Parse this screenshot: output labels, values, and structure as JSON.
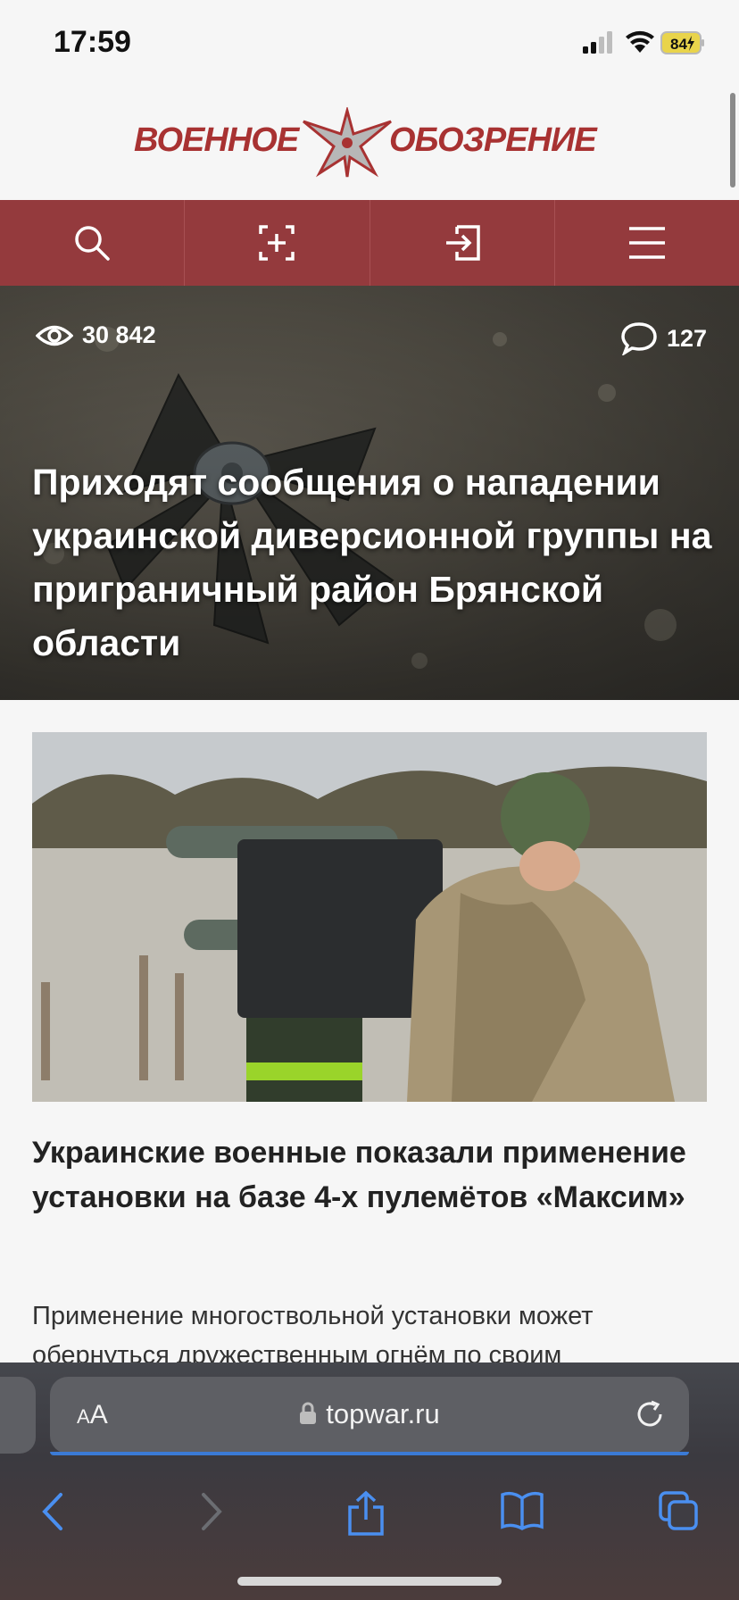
{
  "status": {
    "time": "17:59",
    "battery": "84"
  },
  "logo": {
    "left_word": "ВОЕННОЕ",
    "right_word": "ОБОЗРЕНИЕ"
  },
  "nav": {
    "items": [
      "search-icon",
      "add-icon",
      "login-icon",
      "menu-icon"
    ]
  },
  "hero": {
    "views": "30 842",
    "comments": "127",
    "title": "Приходят сообщения о нападении украинской диверсионной группы на приграничный район Брянской области"
  },
  "article": {
    "title": "Украинские военные показали применение установки на базе 4-х пулемётов «Максим»",
    "excerpt": "Применение многоствольной установки может обернуться дружественным огнём по своим"
  },
  "browser": {
    "aa_label_small": "A",
    "aa_label_big": "A",
    "domain": "topwar.ru",
    "toolbar": [
      "back-icon",
      "forward-icon",
      "share-icon",
      "bookmarks-icon",
      "tabs-icon"
    ]
  },
  "colors": {
    "brand": "#943a3d",
    "logo_red": "#a83232",
    "link_blue": "#3b7bd6"
  }
}
